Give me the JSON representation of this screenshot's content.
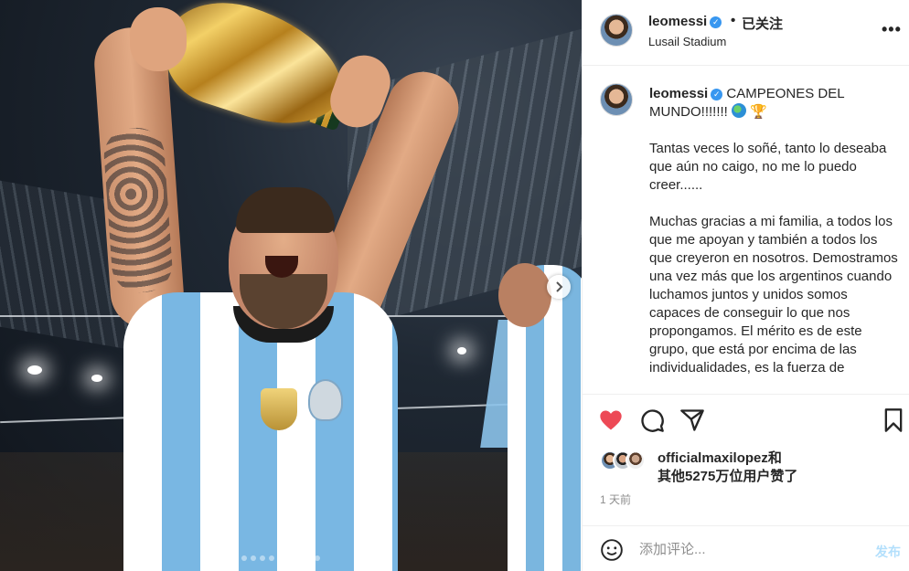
{
  "post": {
    "username": "leomessi",
    "verified": true,
    "separator": "•",
    "follow_status": "已关注",
    "location": "Lusail Stadium",
    "more_icon": "more-horizontal-icon",
    "photo": {
      "description_icon": "photo-messi-trophy",
      "next_icon": "chevron-right-icon",
      "carousel_count": 10,
      "carousel_active": 0
    }
  },
  "caption": {
    "username": "leomessi",
    "first_line": "CAMPEONES DEL MUNDO!!!!!!!",
    "emoji": [
      "globe-icon",
      "trophy-icon"
    ],
    "paragraph_1": "Tantas veces lo soñé, tanto lo deseaba que aún no caigo, no me lo puedo creer......",
    "paragraph_2": "Muchas gracias a mi familia, a todos los que me apoyan y también a todos los que creyeron en nosotros. Demostramos una vez más que los argentinos cuando luchamos juntos y unidos somos capaces de conseguir lo que nos propongamos. El mérito es de este grupo, que está por encima de las individualidades, es la fuerza de"
  },
  "actions": {
    "like_icon": "heart-filled-icon",
    "comment_icon": "comment-icon",
    "share_icon": "share-icon",
    "save_icon": "bookmark-icon",
    "like_color": "#ed4956"
  },
  "likes": {
    "liked_by": "officialmaxilopez和",
    "others": "其他5275万位用户赞了"
  },
  "timestamp": "1 天前",
  "comment": {
    "emoji_icon": "smiley-icon",
    "placeholder": "添加评论...",
    "post_label": "发布"
  }
}
